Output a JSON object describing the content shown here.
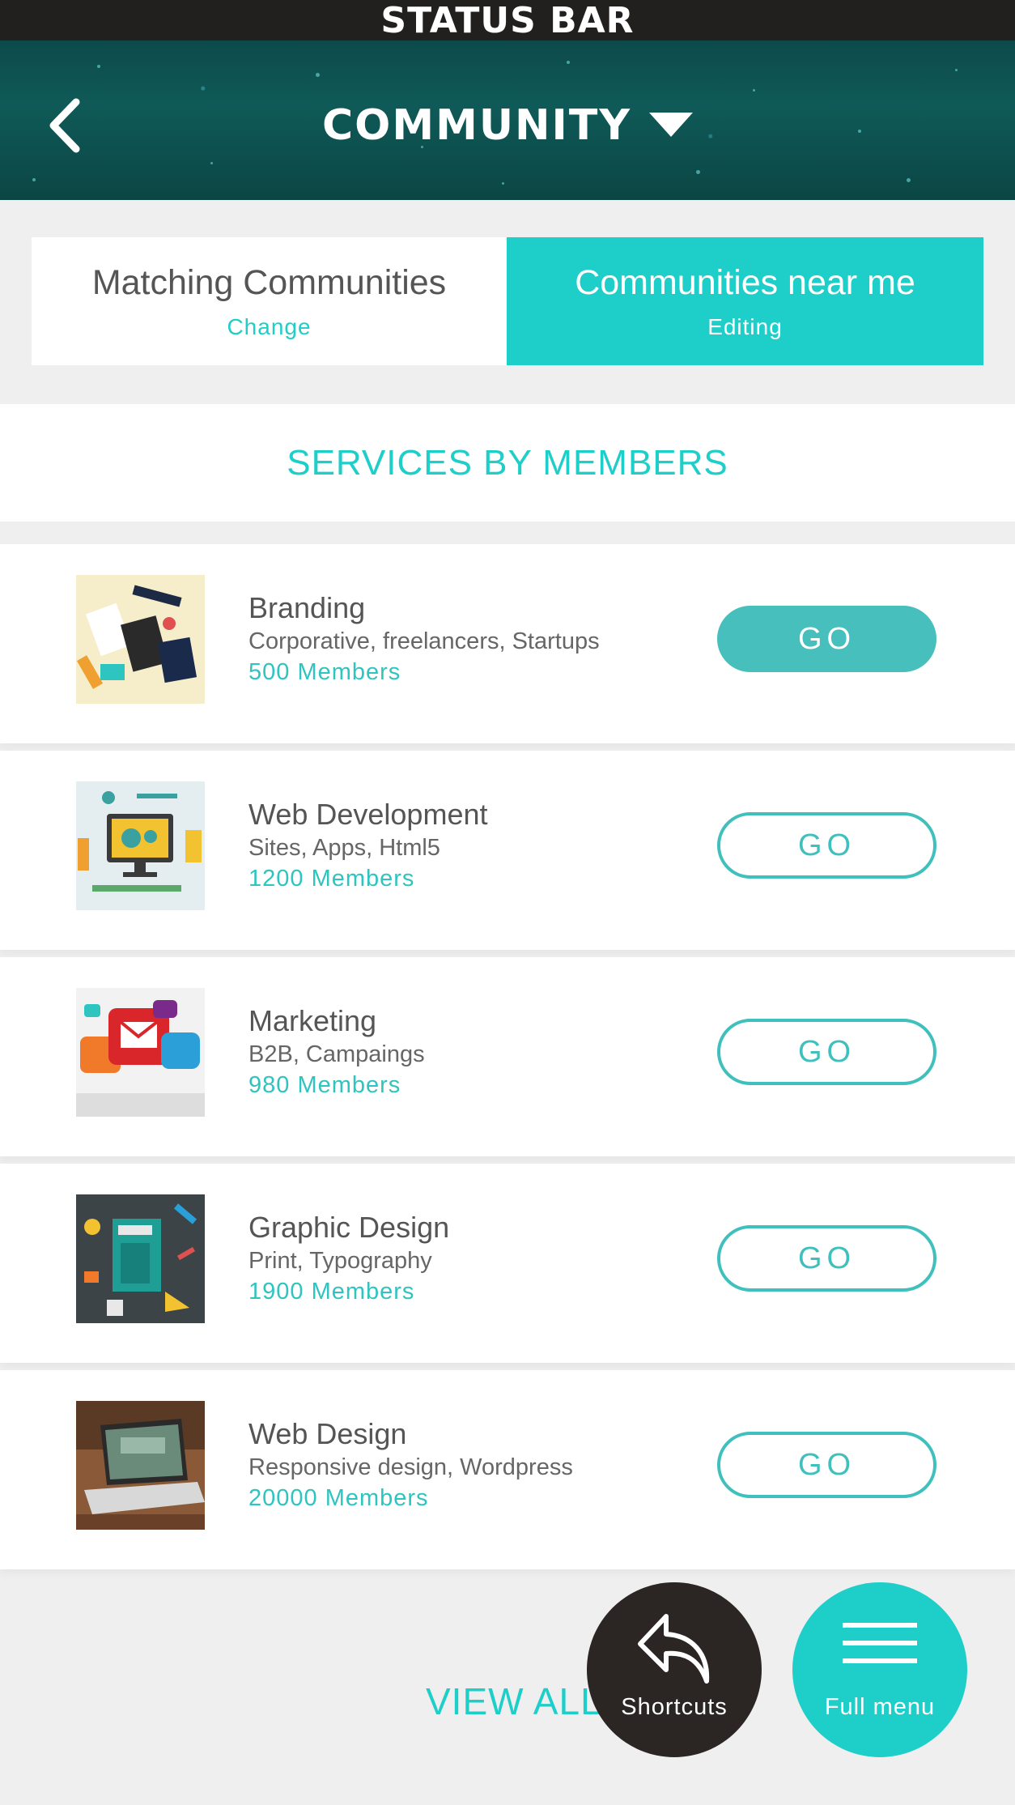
{
  "status_bar": {
    "label": "STATUS BAR"
  },
  "header": {
    "title": "COMMUNITY",
    "back_icon": "chevron-left-icon",
    "dropdown_icon": "caret-down-icon"
  },
  "segments": [
    {
      "label": "Matching Communities",
      "sublabel": "Change",
      "active": false
    },
    {
      "label": "Communities near me",
      "sublabel": "Editing",
      "active": true
    }
  ],
  "section": {
    "title": "SERVICES BY MEMBERS"
  },
  "communities": [
    {
      "name": "Branding",
      "tags": "Corporative, freelancers, Startups",
      "members": "500 Members",
      "button": "GO",
      "button_style": "filled"
    },
    {
      "name": "Web Development",
      "tags": "Sites, Apps, Html5",
      "members": "1200 Members",
      "button": "GO",
      "button_style": "outline"
    },
    {
      "name": "Marketing",
      "tags": "B2B, Campaings",
      "members": "980 Members",
      "button": "GO",
      "button_style": "outline"
    },
    {
      "name": "Graphic Design",
      "tags": "Print, Typography",
      "members": "1900 Members",
      "button": "GO",
      "button_style": "outline"
    },
    {
      "name": "Web Design",
      "tags": "Responsive design, Wordpress",
      "members": "20000 Members",
      "button": "GO",
      "button_style": "outline"
    }
  ],
  "footer": {
    "view_all": "VIEW ALL"
  },
  "fabs": {
    "shortcuts": {
      "label": "Shortcuts",
      "icon": "reply-arrow-icon"
    },
    "menu": {
      "label": "Full menu",
      "icon": "hamburger-icon"
    }
  },
  "colors": {
    "accent": "#1ecfc9",
    "status_bar": "#221f1f",
    "fab_dark": "#2b2624"
  }
}
